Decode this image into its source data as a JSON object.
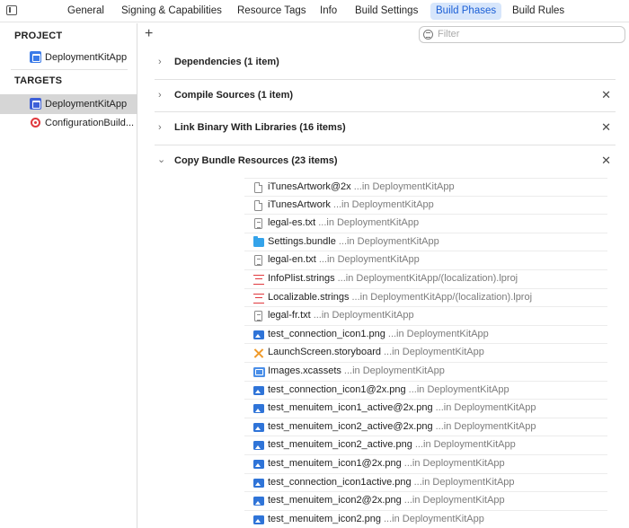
{
  "tabs": [
    {
      "label": "General",
      "active": false
    },
    {
      "label": "Signing & Capabilities",
      "active": false
    },
    {
      "label": "Resource Tags",
      "active": false
    },
    {
      "label": "Info",
      "active": false
    },
    {
      "label": "Build Settings",
      "active": false
    },
    {
      "label": "Build Phases",
      "active": true
    },
    {
      "label": "Build Rules",
      "active": false
    }
  ],
  "sidebar": {
    "project_header": "PROJECT",
    "project_item": "DeploymentKitApp",
    "targets_header": "TARGETS",
    "targets": [
      {
        "label": "DeploymentKitApp",
        "selected": true,
        "icon": "app-target-icon"
      },
      {
        "label": "ConfigurationBuild...",
        "selected": false,
        "icon": "target-icon"
      }
    ]
  },
  "toolbar": {
    "add_label": "+",
    "filter_placeholder": "Filter"
  },
  "phases": [
    {
      "title": "Dependencies (1 item)",
      "expanded": false,
      "removable": false
    },
    {
      "title": "Compile Sources (1 item)",
      "expanded": false,
      "removable": true
    },
    {
      "title": "Link Binary With Libraries (16 items)",
      "expanded": false,
      "removable": true
    },
    {
      "title": "Copy Bundle Resources (23 items)",
      "expanded": true,
      "removable": true
    }
  ],
  "files": [
    {
      "name": "iTunesArtwork@2x",
      "location": "...in DeploymentKitApp",
      "icon": "doc"
    },
    {
      "name": "iTunesArtwork",
      "location": "...in DeploymentKitApp",
      "icon": "doc"
    },
    {
      "name": "legal-es.txt",
      "location": "...in DeploymentKitApp",
      "icon": "txt"
    },
    {
      "name": "Settings.bundle",
      "location": "...in DeploymentKitApp",
      "icon": "bundle"
    },
    {
      "name": "legal-en.txt",
      "location": "...in DeploymentKitApp",
      "icon": "txt"
    },
    {
      "name": "InfoPlist.strings",
      "location": "...in DeploymentKitApp/(localization).lproj",
      "icon": "strings"
    },
    {
      "name": "Localizable.strings",
      "location": "...in DeploymentKitApp/(localization).lproj",
      "icon": "strings"
    },
    {
      "name": "legal-fr.txt",
      "location": "...in DeploymentKitApp",
      "icon": "txt"
    },
    {
      "name": "test_connection_icon1.png",
      "location": "...in DeploymentKitApp",
      "icon": "image"
    },
    {
      "name": "LaunchScreen.storyboard",
      "location": "...in DeploymentKitApp",
      "icon": "storyboard"
    },
    {
      "name": "Images.xcassets",
      "location": "...in DeploymentKitApp",
      "icon": "assets"
    },
    {
      "name": "test_connection_icon1@2x.png",
      "location": "...in DeploymentKitApp",
      "icon": "image"
    },
    {
      "name": "test_menuitem_icon1_active@2x.png",
      "location": "...in DeploymentKitApp",
      "icon": "image"
    },
    {
      "name": "test_menuitem_icon2_active@2x.png",
      "location": "...in DeploymentKitApp",
      "icon": "image"
    },
    {
      "name": "test_menuitem_icon2_active.png",
      "location": "...in DeploymentKitApp",
      "icon": "image"
    },
    {
      "name": "test_menuitem_icon1@2x.png",
      "location": "...in DeploymentKitApp",
      "icon": "image"
    },
    {
      "name": "test_connection_icon1active.png",
      "location": "...in DeploymentKitApp",
      "icon": "image"
    },
    {
      "name": "test_menuitem_icon2@2x.png",
      "location": "...in DeploymentKitApp",
      "icon": "image"
    },
    {
      "name": "test_menuitem_icon2.png",
      "location": "...in DeploymentKitApp",
      "icon": "image"
    }
  ],
  "colors": {
    "accent": "#1b5fd6",
    "active_tab_bg": "#d7e6fb",
    "selected_row_bg": "#d6d6d6"
  }
}
